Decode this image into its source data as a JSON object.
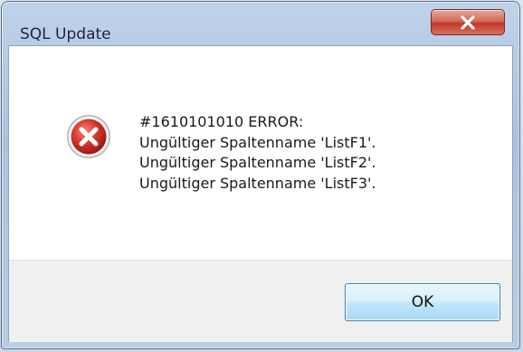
{
  "window": {
    "title": "SQL Update"
  },
  "titlebar": {
    "close_icon": "close-icon",
    "close_color": "#c0392b"
  },
  "dialog": {
    "icon": "error-icon",
    "icon_color": "#d3352c",
    "message_lines": [
      "#1610101010 ERROR:",
      "Ungültiger Spaltenname 'ListF1'.",
      "Ungültiger Spaltenname 'ListF2'.",
      "Ungültiger Spaltenname 'ListF3'."
    ]
  },
  "buttons": {
    "ok_label": "OK"
  }
}
